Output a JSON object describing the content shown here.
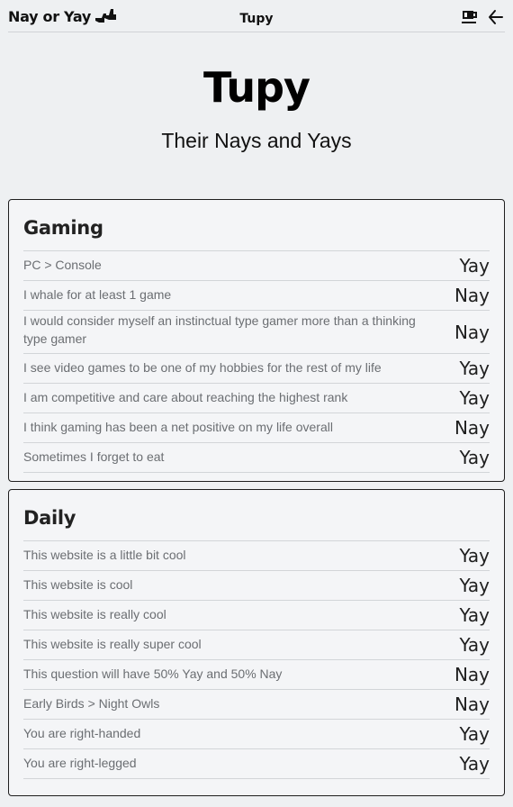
{
  "header": {
    "brand": "Nay or Yay",
    "brand_icon": "thumbs-icon",
    "title": "Tupy",
    "actions": [
      "coffee-icon",
      "arrow-left-icon"
    ]
  },
  "hero": {
    "title": "Tupy",
    "subtitle": "Their Nays and Yays"
  },
  "sections": [
    {
      "title": "Gaming",
      "items": [
        {
          "question": "PC > Console",
          "answer": "Yay"
        },
        {
          "question": "I whale for at least 1 game",
          "answer": "Nay"
        },
        {
          "question": "I would consider myself an instinctual type gamer more than a thinking type gamer",
          "answer": "Nay"
        },
        {
          "question": "I see video games to be one of my hobbies for the rest of my life",
          "answer": "Yay"
        },
        {
          "question": "I am competitive and care about reaching the highest rank",
          "answer": "Yay"
        },
        {
          "question": "I think gaming has been a net positive on my life overall",
          "answer": "Nay"
        },
        {
          "question": "Sometimes I forget to eat",
          "answer": "Yay"
        }
      ]
    },
    {
      "title": "Daily",
      "items": [
        {
          "question": "This website is a little bit cool",
          "answer": "Yay"
        },
        {
          "question": "This website is cool",
          "answer": "Yay"
        },
        {
          "question": "This website is really cool",
          "answer": "Yay"
        },
        {
          "question": "This website is really super cool",
          "answer": "Yay"
        },
        {
          "question": "This question will have 50% Yay and 50% Nay",
          "answer": "Nay"
        },
        {
          "question": "Early Birds > Night Owls",
          "answer": "Nay"
        },
        {
          "question": "You are right-handed",
          "answer": "Yay"
        },
        {
          "question": "You are right-legged",
          "answer": "Yay"
        }
      ]
    }
  ]
}
